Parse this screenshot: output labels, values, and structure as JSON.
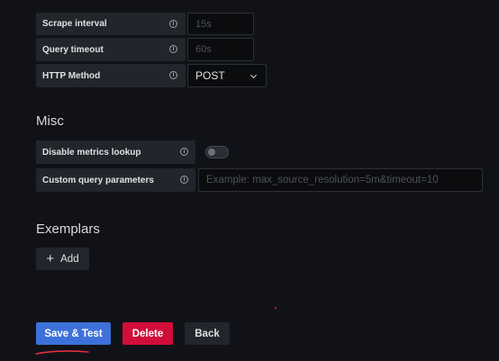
{
  "http_section": {
    "scrape_interval": {
      "label": "Scrape interval",
      "placeholder": "15s"
    },
    "query_timeout": {
      "label": "Query timeout",
      "placeholder": "60s"
    },
    "http_method": {
      "label": "HTTP Method",
      "selected": "POST"
    }
  },
  "misc": {
    "title": "Misc",
    "disable_metrics_lookup": {
      "label": "Disable metrics lookup",
      "enabled": false
    },
    "custom_query_parameters": {
      "label": "Custom query parameters",
      "placeholder": "Example: max_source_resolution=5m&timeout=10"
    }
  },
  "exemplars": {
    "title": "Exemplars",
    "add_label": "Add"
  },
  "footer": {
    "save_label": "Save & Test",
    "delete_label": "Delete",
    "back_label": "Back"
  },
  "info_glyph": "i",
  "colors": {
    "background": "#111217",
    "primary": "#3d71d9",
    "destructive": "#d10e3a",
    "secondary": "#22252b",
    "annotation": "#e02f44"
  }
}
